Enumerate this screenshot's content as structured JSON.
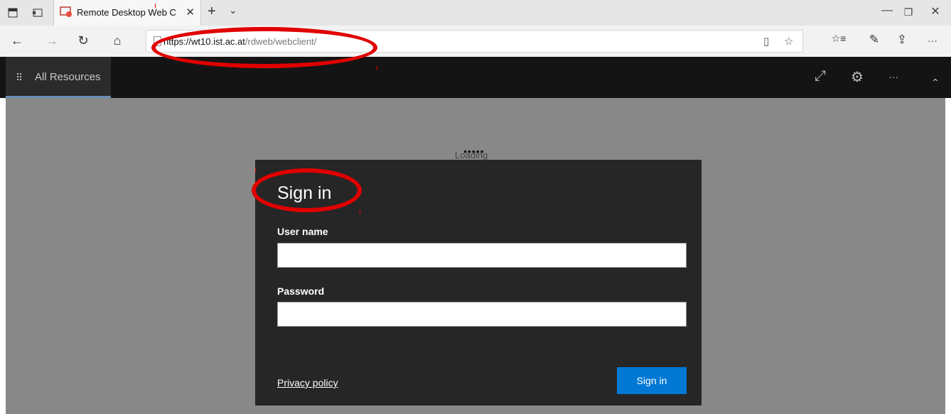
{
  "browser": {
    "tab": {
      "title": "Remote Desktop Web C",
      "close_glyph": "✕"
    },
    "new_tab_glyph": "+",
    "tab_list_glyph": "⌄",
    "window_buttons": {
      "minimize": "—",
      "restore": "❐",
      "close": "✕"
    },
    "nav": {
      "back": "←",
      "forward": "→",
      "refresh": "↻",
      "home": "⌂"
    },
    "address": {
      "host": "https://wt10.ist.ac.at",
      "path": "/rdweb/webclient/"
    },
    "address_icons": {
      "reading_view": "▯",
      "favorite": "☆"
    },
    "toolbar": {
      "favorites_hub": "☆≡",
      "notes": "✎",
      "share": "⇪",
      "more": "···"
    }
  },
  "appbar": {
    "tab_label": "All Resources",
    "grid_glyph": "⠿",
    "buttons": {
      "expand": "⤢",
      "settings": "⚙",
      "more": "···",
      "collapse": "⌃"
    }
  },
  "content": {
    "loading_text": "Loading",
    "dots": "•••••"
  },
  "dialog": {
    "title": "Sign in",
    "username_label": "User name",
    "username_value": "",
    "password_label": "Password",
    "password_value": "",
    "privacy_link": "Privacy policy",
    "submit_label": "Sign in"
  },
  "colors": {
    "annotation": "#e00000",
    "accent": "#0078d4",
    "dialog_bg": "#262626",
    "appbar_bg": "#141414"
  }
}
